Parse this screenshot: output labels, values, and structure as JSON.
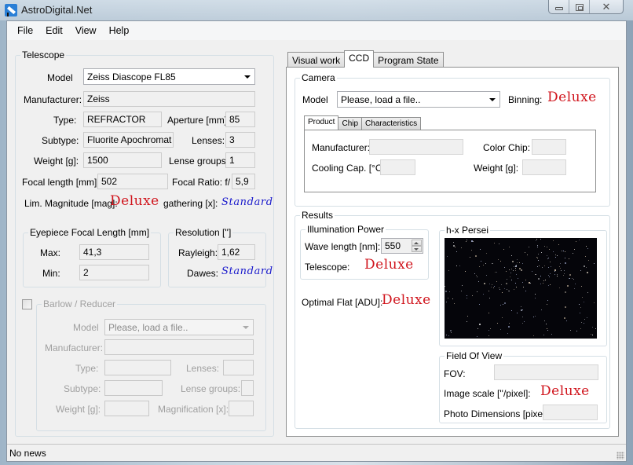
{
  "window": {
    "title": "AstroDigital.Net",
    "controls": {
      "minimize": "minimize",
      "maximize": "maximize",
      "close": "close"
    }
  },
  "menu": [
    "File",
    "Edit",
    "View",
    "Help"
  ],
  "telescope": {
    "group_label": "Telescope",
    "model_label": "Model",
    "model_value": "Zeiss Diascope FL85",
    "manufacturer_label": "Manufacturer:",
    "manufacturer_value": "Zeiss",
    "type_label": "Type:",
    "type_value": "REFRACTOR",
    "aperture_label": "Aperture [mm]:",
    "aperture_value": "85",
    "subtype_label": "Subtype:",
    "subtype_value": "Fluorite Apochromat",
    "lenses_label": "Lenses:",
    "lenses_value": "3",
    "weight_label": "Weight [g]:",
    "weight_value": "1500",
    "lense_groups_label": "Lense groups:",
    "lense_groups_value": "1",
    "focal_length_label": "Focal length [mm]:",
    "focal_length_value": "502",
    "focal_ratio_label": "Focal Ratio: f/",
    "focal_ratio_value": "5,9",
    "lim_magnitude_label": "Lim. Magnitude [mag]:",
    "lim_magnitude_value": "Deluxe",
    "gathering_label": "gathering [x]:",
    "gathering_value": "Standard"
  },
  "eyepiece": {
    "group_label": "Eyepiece Focal Length [mm]",
    "max_label": "Max:",
    "max_value": "41,3",
    "min_label": "Min:",
    "min_value": "2"
  },
  "resolution": {
    "group_label": "Resolution ['']",
    "rayleigh_label": "Rayleigh:",
    "rayleigh_value": "1,62",
    "dawes_label": "Dawes:",
    "dawes_value": "Standard"
  },
  "barlow": {
    "group_label": "Barlow / Reducer",
    "checked": false,
    "model_label": "Model",
    "model_placeholder": "Please, load a file..",
    "manufacturer_label": "Manufacturer:",
    "type_label": "Type:",
    "lenses_label": "Lenses:",
    "subtype_label": "Subtype:",
    "lense_groups_label": "Lense groups:",
    "weight_label": "Weight [g]:",
    "magnification_label": "Magnification [x]:"
  },
  "main_tabs": [
    {
      "label": "Visual work",
      "active": false
    },
    {
      "label": "CCD",
      "active": true
    },
    {
      "label": "Program State",
      "active": false
    }
  ],
  "camera": {
    "group_label": "Camera",
    "model_label": "Model",
    "model_placeholder": "Please, load a file..",
    "binning_label": "Binning:",
    "binning_value": "Deluxe",
    "subtabs": [
      {
        "label": "Product",
        "active": true
      },
      {
        "label": "Chip",
        "active": false
      },
      {
        "label": "Characteristics",
        "active": false
      }
    ],
    "manufacturer_label": "Manufacturer:",
    "manufacturer_value": "",
    "color_chip_label": "Color Chip:",
    "color_chip_value": "",
    "cooling_label": "Cooling Cap. [°C]:",
    "cooling_value": "",
    "weight_label": "Weight [g]:",
    "weight_value": ""
  },
  "results": {
    "group_label": "Results",
    "illumination": {
      "group_label": "Illumination Power",
      "wavelength_label": "Wave length [nm]:",
      "wavelength_value": "550",
      "telescope_label": "Telescope:",
      "telescope_value": "Deluxe"
    },
    "optimal_flat_label": "Optimal Flat [ADU]:",
    "optimal_flat_value": "Deluxe",
    "preview": {
      "group_label": "h-x Persei",
      "image": "star field photo of h and chi Persei double cluster"
    },
    "fov": {
      "group_label": "Field Of View",
      "fov_label": "FOV:",
      "fov_value": "",
      "image_scale_label": "Image scale [''/pixel]:",
      "image_scale_value": "Deluxe",
      "photo_dim_label": "Photo Dimensions [pixel]:",
      "photo_dim_value": ""
    }
  },
  "status": {
    "text": "No news"
  }
}
